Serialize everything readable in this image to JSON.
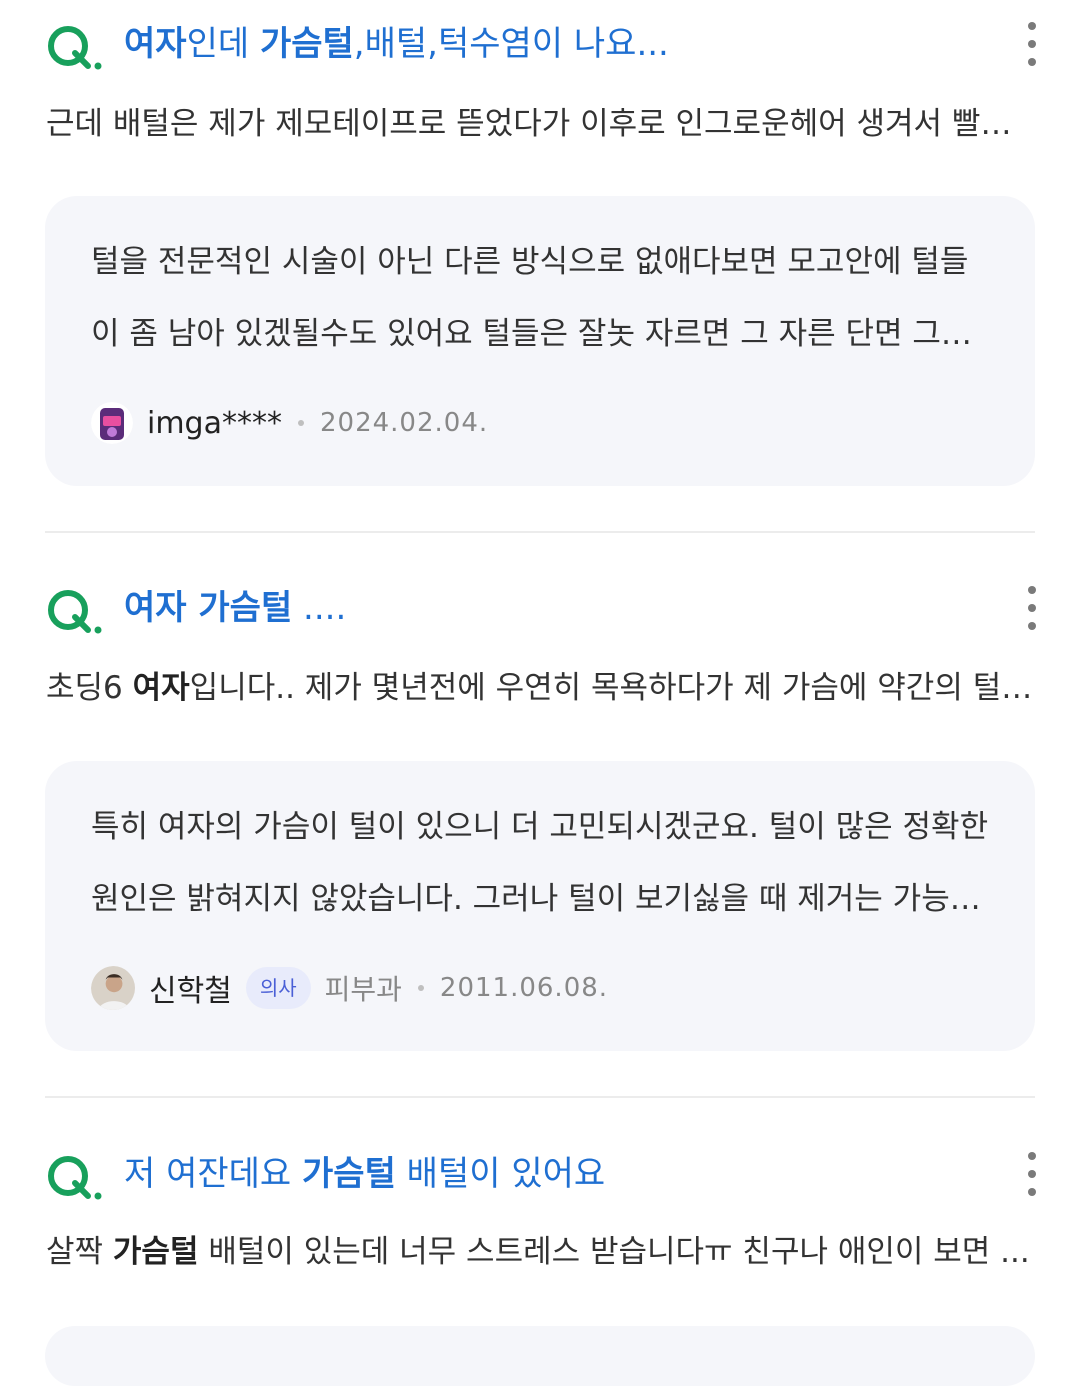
{
  "results": [
    {
      "title_parts": [
        {
          "text": "여자",
          "bold": true
        },
        {
          "text": "인데 ",
          "bold": false
        },
        {
          "text": "가슴털",
          "bold": true
        },
        {
          "text": ",배털,턱수염이 나요...",
          "bold": false
        }
      ],
      "desc_parts": [
        {
          "text": "근데 배털은 제가 제모테이프로 뜯었다가 이후로 인그로운헤어 생겨서 빨간 ...",
          "bold": false
        }
      ],
      "answer": {
        "text": "털을 전문적인 시술이 아닌 다른 방식으로 없애다보면 모고안에 털들이 좀 남아 있겠될수도 있어요 털들은 잘놋 자르면 그 자른 단면 그대로 다...",
        "user": "imga****",
        "date": "2024.02.04."
      }
    },
    {
      "title_parts": [
        {
          "text": "여자 가슴털",
          "bold": true
        },
        {
          "text": " ....",
          "bold": false
        }
      ],
      "desc_parts": [
        {
          "text": "초딩6 ",
          "bold": false
        },
        {
          "text": "여자",
          "bold": true
        },
        {
          "text": "입니다.. 제가 몇년전에 우연히 목욕하다가 제 가슴에 약간의 털 ...",
          "bold": false
        }
      ],
      "answer": {
        "text": "특히 여자의 가슴이 털이 있으니 더 고민되시겠군요. 털이 많은 정확한 원인은 밝혀지지 않았습니다. 그러나 털이 보기싫을 때 제거는 가능합...",
        "user": "신학철",
        "badge": "의사",
        "dept": "피부과",
        "date": "2011.06.08."
      }
    },
    {
      "title_parts": [
        {
          "text": "저 여잔데요 ",
          "bold": false
        },
        {
          "text": "가슴털",
          "bold": true
        },
        {
          "text": " 배털이 있어요",
          "bold": false
        }
      ],
      "desc_parts": [
        {
          "text": "살짝 ",
          "bold": false
        },
        {
          "text": "가슴털",
          "bold": true
        },
        {
          "text": " 배털이 있는데 너무 스트레스 받습니다ㅠ 친구나 애인이 보면 ...",
          "bold": false
        }
      ]
    }
  ],
  "icons": {
    "question": "q-icon",
    "more": "more-vertical-icon"
  },
  "colors": {
    "accent": "#1f6fd1",
    "q_green": "#18a05c",
    "card_bg": "#f5f6fa",
    "badge_bg": "#e8ebfb",
    "badge_text": "#4a5fd6"
  }
}
